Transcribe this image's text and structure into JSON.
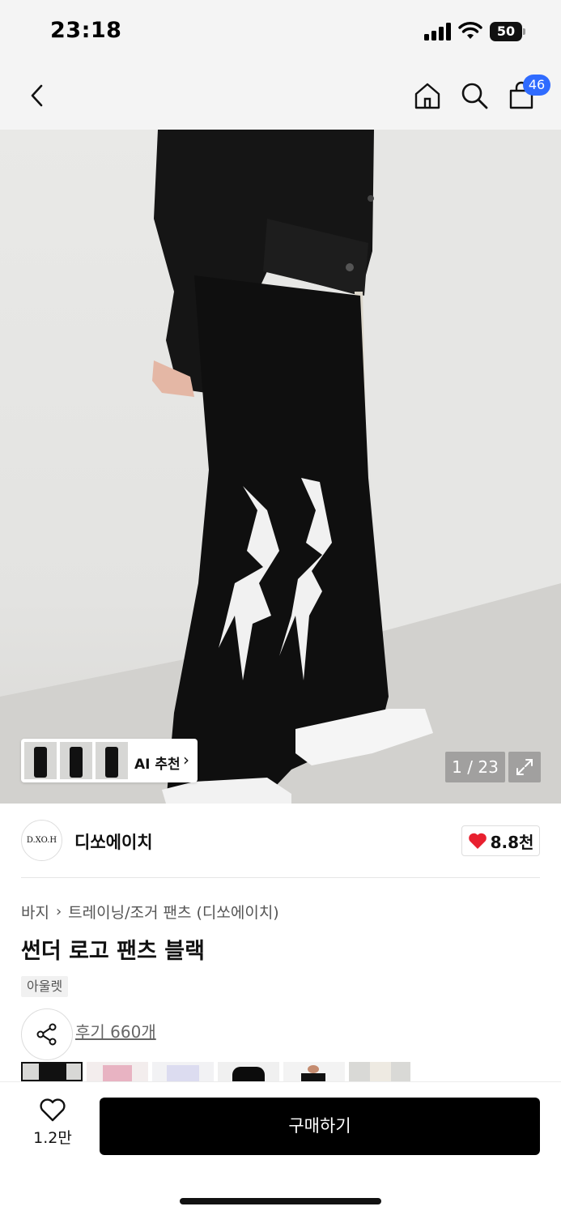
{
  "status_bar": {
    "time": "23:18",
    "battery_level": "50"
  },
  "nav": {
    "cart_count": "46"
  },
  "hero": {
    "ai_recommend_label": "AI 추천",
    "image_counter": "1 / 23"
  },
  "brand": {
    "logo_text": "D.XO.H",
    "name": "디쏘에이치",
    "like_count": "8.8천"
  },
  "product": {
    "breadcrumb": [
      "바지",
      "트레이닝/조거 팬츠 (디쏘에이치)"
    ],
    "title": "썬더 로고 팬츠 블랙",
    "tag": "아울렛",
    "review_link": "후기 660개"
  },
  "bottom_bar": {
    "wish_count": "1.2만",
    "buy_label": "구매하기"
  },
  "colors": {
    "accent_badge": "#2f6bff",
    "heart_red": "#e8202f",
    "buy_button": "#000000"
  },
  "icons": [
    "back-icon",
    "home-icon",
    "search-icon",
    "cart-icon",
    "expand-icon",
    "share-icon",
    "heart-icon",
    "chevron-right-icon"
  ]
}
